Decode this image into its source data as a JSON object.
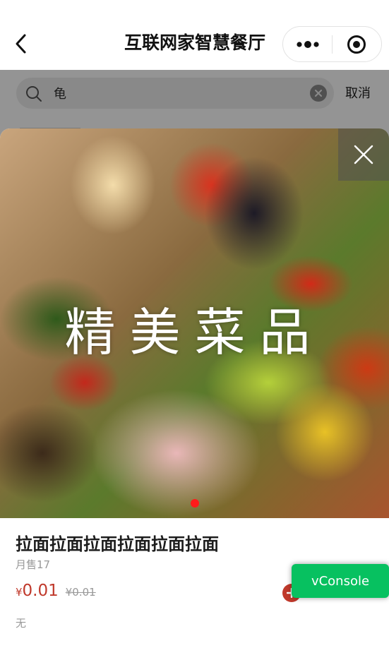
{
  "nav": {
    "title": "互联网家智慧餐厅"
  },
  "search": {
    "value": "龟",
    "placeholder": "",
    "cancel_label": "取消"
  },
  "popup": {
    "banner_text": "精美菜品",
    "banner_dots": 1,
    "dish_name": "拉面拉面拉面拉面拉面拉面",
    "monthly_sales": "月售17",
    "price_symbol": "¥",
    "price": "0.01",
    "original_price": "¥0.01",
    "description": "无"
  },
  "vconsole": {
    "label": "vConsole"
  },
  "colors": {
    "accent_red": "#c0392b",
    "dot_red": "#ff1a1a",
    "vconsole_green": "#07c160"
  },
  "icons": [
    "back-icon",
    "more-icon",
    "target-icon",
    "search-icon",
    "clear-icon",
    "close-icon",
    "plus-icon"
  ]
}
